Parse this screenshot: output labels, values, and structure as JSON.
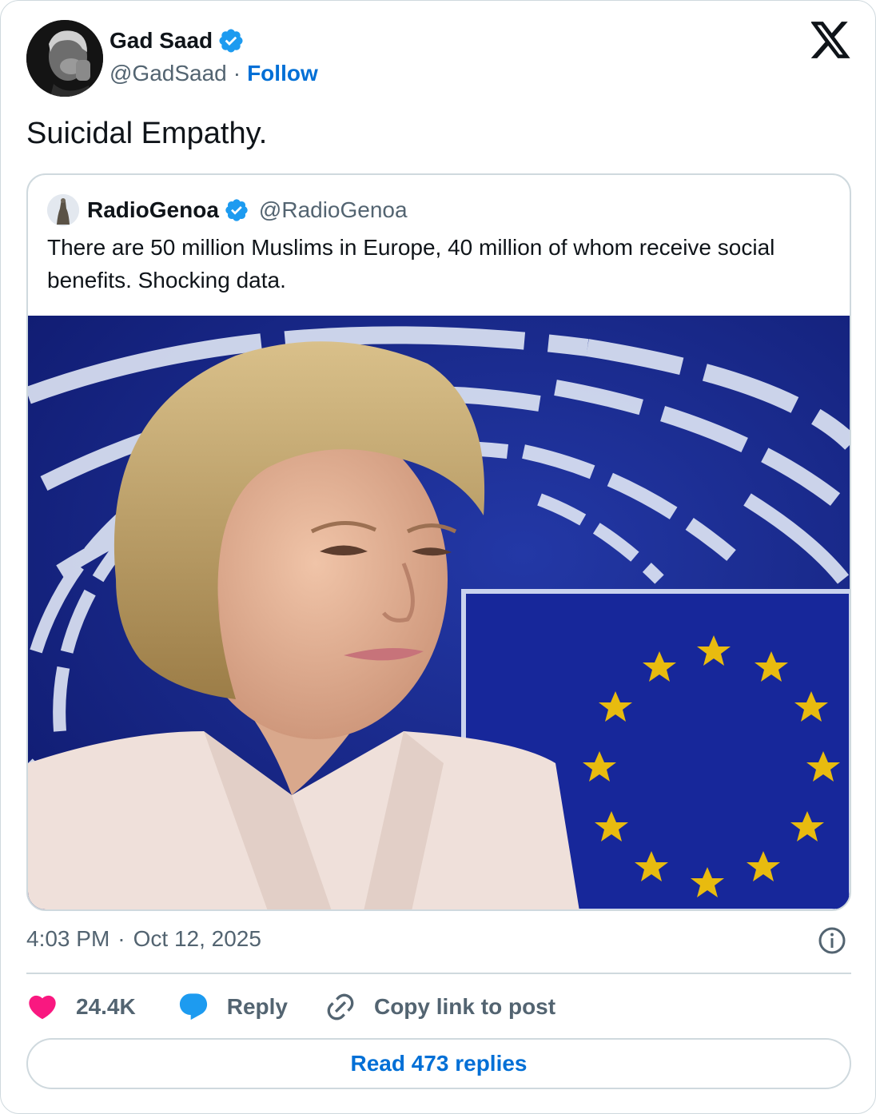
{
  "author": {
    "name": "Gad Saad",
    "handle": "@GadSaad",
    "separator": "·",
    "follow_label": "Follow"
  },
  "post": {
    "text": "Suicidal Empathy."
  },
  "quoted": {
    "name": "RadioGenoa",
    "handle": "@RadioGenoa",
    "text": "There are 50 million Muslims in Europe, 40 million of whom receive social benefits. Shocking data."
  },
  "meta": {
    "time": "4:03 PM",
    "separator": "·",
    "date": "Oct 12, 2025"
  },
  "actions": {
    "like_count": "24.4K",
    "reply_label": "Reply",
    "copy_label": "Copy link to post"
  },
  "read_replies_label": "Read 473 replies",
  "colors": {
    "link_blue": "#006fd6",
    "like_pink": "#f91880",
    "reply_blue": "#1d9bf0",
    "verified_blue": "#1d9bf0",
    "muted_text": "#536471",
    "border": "#cfd9de",
    "eu_blue": "#1b2a8a",
    "eu_star": "#ffcc00"
  }
}
